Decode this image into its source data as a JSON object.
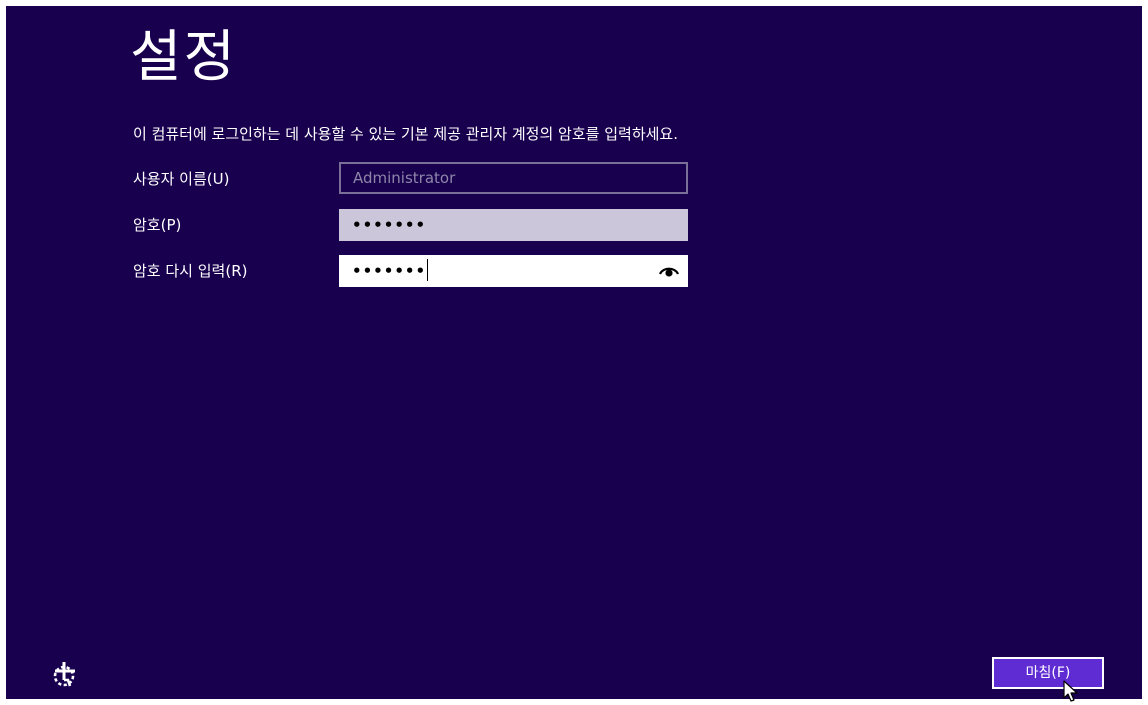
{
  "page": {
    "title": "설정",
    "instruction": "이 컴퓨터에 로그인하는 데 사용할 수 있는 기본 제공 관리자 계정의 암호를 입력하세요."
  },
  "form": {
    "username": {
      "label": "사용자 이름(U)",
      "value": "Administrator"
    },
    "password": {
      "label": "암호(P)",
      "masked_value": "•••••••"
    },
    "reenter_password": {
      "label": "암호 다시 입력(R)",
      "masked_value": "•••••••",
      "reveal_icon": "eye-icon"
    }
  },
  "footer": {
    "ease_of_access_icon": "ease-of-access-icon",
    "finish_label": "마침(F)"
  },
  "colors": {
    "background": "#18004f",
    "button": "#5f2bd3",
    "disabled_border": "#7a6f96",
    "password_field": "#ccc6db"
  }
}
